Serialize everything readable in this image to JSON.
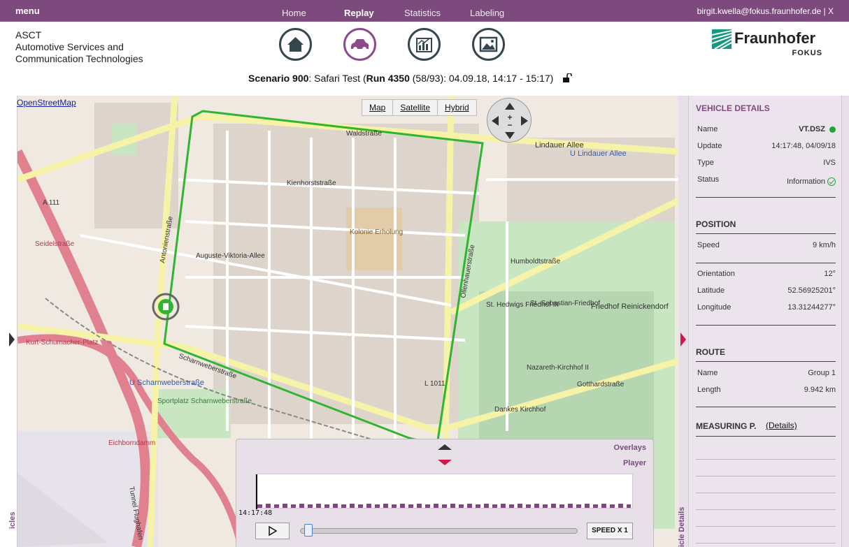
{
  "topbar": {
    "menu": "menu",
    "nav": [
      "Home",
      "Replay",
      "Statistics",
      "Labeling"
    ],
    "user": "birgit.kwella@fokus.fraunhofer.de  |  X"
  },
  "org": {
    "line1": "ASCT",
    "line2": "Automotive Services and",
    "line3": "Communication Technologies"
  },
  "icons": [
    "home-icon",
    "car-icon",
    "statistics-icon",
    "picture-icon"
  ],
  "logo": {
    "word": "Fraunhofer",
    "sub": "FOKUS"
  },
  "scenario": {
    "label": "Scenario 900",
    "name": ": Safari Test (",
    "run": "Run 4350",
    "rest": " (58/93): 04.09.18, 14:17 - 15:17)"
  },
  "map": {
    "attribution": "OpenStreetMap",
    "types": [
      "Map",
      "Satellite",
      "Hybrid"
    ],
    "labels": {
      "waldstrasse": "Waldstraße",
      "lindauer": "Lindauer Allee",
      "u_lindauer": "U Lindauer Allee",
      "kienhorst": "Kienhorststraße",
      "auguste": "Auguste-Viktoria-Allee",
      "scharnweber": "Scharnweberstraße",
      "u_scharnweber": "U Scharnweberstraße",
      "kurt": "Kurt-Schumacher-Platz",
      "seidel": "Seidelstraße",
      "a111": "A 111",
      "friedhof": "Friedhof Reinickendorf",
      "kolonie": "Kolonie Erholung",
      "humboldt": "Humboldtstraße",
      "oll": "Ollenhauerstraße",
      "antonien": "Antonienstraße",
      "eichborndamm": "Eichborndamm",
      "gotthard": "Gotthardstraße",
      "sportplatz": "Sportplatz Scharnweberstraße",
      "l1011": "L 1011",
      "dankes": "Dankes Kirchhof",
      "nazareth": "Nazareth-Kirchhof II",
      "hedwigs": "St. Hedwigs Friedhof III",
      "sebastian": "St.-Sebastian-Friedhof",
      "tunnel": "Tunnel Flughafen"
    }
  },
  "player": {
    "overlays": "Overlays",
    "player": "Player",
    "timestamp": "14:17:48",
    "speed": "SPEED X 1"
  },
  "vehicle": {
    "title": "VEHICLE DETAILS",
    "rows": [
      {
        "k": "Name",
        "v": "VT.DSZ"
      },
      {
        "k": "Update",
        "v": "14:17:48, 04/09/18"
      },
      {
        "k": "Type",
        "v": "IVS"
      },
      {
        "k": "Status",
        "v": "Information"
      }
    ]
  },
  "position": {
    "title": "POSITION",
    "speed_k": "Speed",
    "speed_v": "9 km/h",
    "rows": [
      {
        "k": "Orientation",
        "v": "12°"
      },
      {
        "k": "Latitude",
        "v": "52.56925201°"
      },
      {
        "k": "Longitude",
        "v": "13.31244277°"
      }
    ]
  },
  "route": {
    "title": "ROUTE",
    "rows": [
      {
        "k": "Name",
        "v": "Group 1"
      },
      {
        "k": "Length",
        "v": "9.942 km"
      }
    ]
  },
  "measuring": {
    "title": "MEASURING P.",
    "details": "(Details)"
  },
  "side_tabs": {
    "left": "icles",
    "right": "icle Details"
  }
}
